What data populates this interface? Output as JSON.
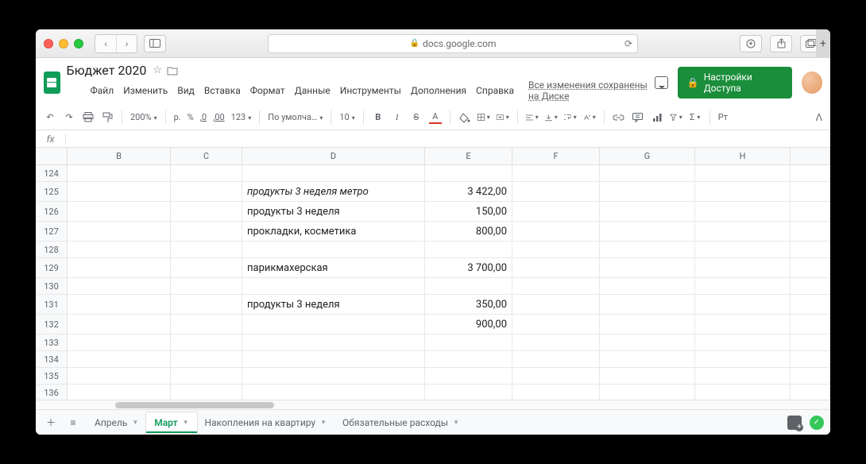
{
  "browser": {
    "url_host": "docs.google.com"
  },
  "doc": {
    "title": "Бюджет 2020",
    "saved_msg": "Все изменения сохранены на Диске",
    "share_label": "Настройки Доступа"
  },
  "menus": [
    "Файл",
    "Изменить",
    "Вид",
    "Вставка",
    "Формат",
    "Данные",
    "Инструменты",
    "Дополнения",
    "Справка"
  ],
  "toolbar": {
    "zoom": "200%",
    "currency": "р.",
    "pct": "%",
    "dec_dec": ",0",
    "dec_inc": ",00",
    "num123": "123",
    "font": "По умолча…",
    "size": "10",
    "pivot": "Рт"
  },
  "fx_label": "fx",
  "columns": [
    "B",
    "C",
    "D",
    "E",
    "F",
    "G",
    "H"
  ],
  "row_start": 124,
  "row_count": 15,
  "cells": {
    "125": {
      "D": {
        "v": "продукты 3 неделя метро",
        "italic": true
      },
      "E": "3 422,00"
    },
    "126": {
      "D": {
        "v": "продукты 3 неделя"
      },
      "E": "150,00"
    },
    "127": {
      "D": {
        "v": "прокладки, косметика"
      },
      "E": "800,00"
    },
    "129": {
      "D": {
        "v": "парикмахерская"
      },
      "E": "3 700,00"
    },
    "131": {
      "D": {
        "v": "продукты 3 неделя"
      },
      "E": "350,00"
    },
    "132": {
      "E": "900,00"
    }
  },
  "tall_rows": [
    125,
    126,
    127,
    129,
    131,
    132
  ],
  "sheet_tabs": [
    {
      "label": "Апрель",
      "active": false
    },
    {
      "label": "Март",
      "active": true
    },
    {
      "label": "Накопления на квартиру",
      "active": false
    },
    {
      "label": "Обязательные расходы",
      "active": false
    }
  ]
}
